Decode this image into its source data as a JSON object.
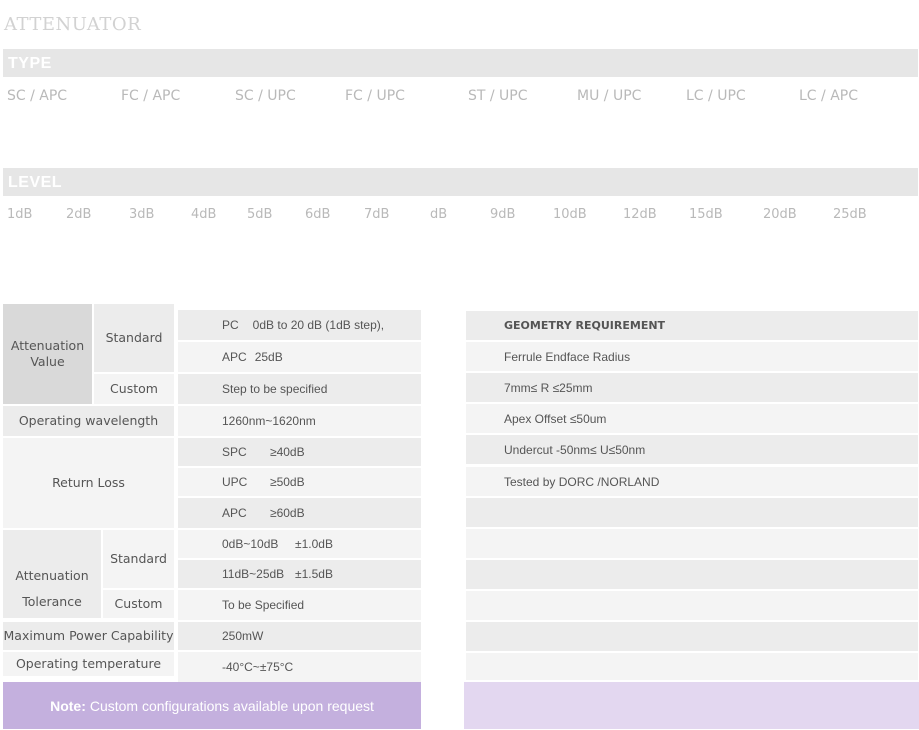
{
  "title": "ATTENUATOR",
  "type_section": {
    "label": "TYPE",
    "options": [
      "SC / APC",
      "FC / APC",
      "SC / UPC",
      "FC / UPC",
      "ST / UPC",
      "MU / UPC",
      "LC / UPC",
      "LC / APC"
    ]
  },
  "level_section": {
    "label": "LEVEL",
    "options": [
      "1dB",
      "2dB",
      "3dB",
      "4dB",
      "5dB",
      "6dB",
      "7dB",
      "dB",
      "9dB",
      "10dB",
      "12dB",
      "15dB",
      "20dB",
      "25dB"
    ]
  },
  "spec_table": {
    "attenuation_value": {
      "label": "Attenuation Value",
      "standard_label": "Standard",
      "custom_label": "Custom",
      "pc_name": "PC",
      "pc_value": "0dB to 20 dB (1dB step),",
      "apc_name": "APC",
      "apc_value": "25dB",
      "custom_value": "Step to be specified"
    },
    "operating_wavelength": {
      "label": "Operating wavelength",
      "value": "1260nm~1620nm"
    },
    "return_loss": {
      "label": "Return Loss",
      "rows": [
        {
          "name": "SPC",
          "value": "≥40dB"
        },
        {
          "name": "UPC",
          "value": "≥50dB"
        },
        {
          "name": "APC",
          "value": "≥60dB"
        }
      ]
    },
    "attenuation_tolerance": {
      "label_line1": "Attenuation",
      "label_line2": "Tolerance",
      "standard_label": "Standard",
      "custom_label": "Custom",
      "rows": [
        {
          "range": "0dB~10dB",
          "tol": "±1.0dB"
        },
        {
          "range": "11dB~25dB",
          "tol": "±1.5dB"
        }
      ],
      "custom_value": "To be Specified"
    },
    "max_power": {
      "label": "Maximum Power Capability",
      "value": "250mW"
    },
    "operating_temp": {
      "label": "Operating temperature",
      "value": "-40°C~±75°C"
    }
  },
  "geometry_table": {
    "header": "GEOMETRY REQUIREMENT",
    "rows": [
      "Ferrule Endface Radius",
      "7mm≤ R ≤25mm",
      "Apex Offset ≤50um",
      "Undercut  -50nm≤ U≤50nm",
      "Tested by DORC /NORLAND",
      "",
      "",
      "",
      "",
      "",
      ""
    ]
  },
  "note": {
    "label": "Note:",
    "text": "Custom configurations available upon request"
  },
  "colors": {
    "bar_grey": "#e6e6e6",
    "label_cell": "#d9d9d9",
    "row_light": "#f4f4f4",
    "row_mid": "#ececec",
    "note_purple": "#c4b0de",
    "note_purple_light": "#e3d7f0"
  }
}
